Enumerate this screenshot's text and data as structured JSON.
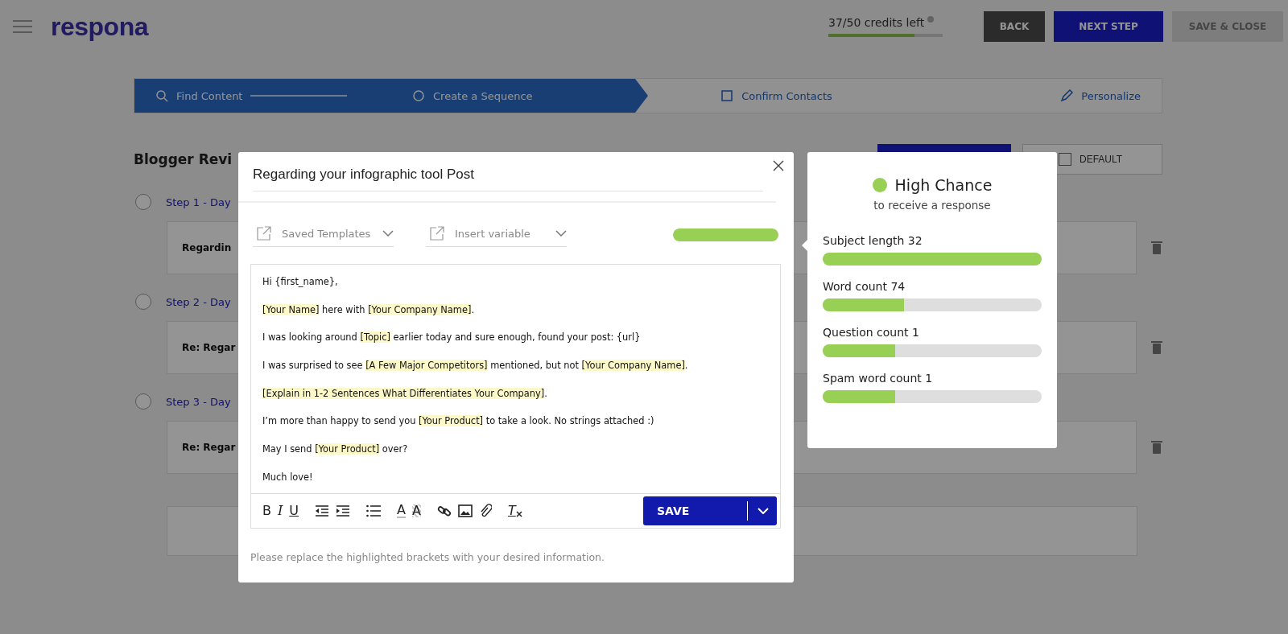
{
  "header": {
    "logo": "respona",
    "credits": {
      "text": "37/50 credits left",
      "level": 0.75
    },
    "buttons": [
      {
        "label": "BACK",
        "kind": "dark"
      },
      {
        "label": "NEXT STEP",
        "kind": "primary"
      },
      {
        "label": "SAVE & CLOSE",
        "kind": "disabled"
      }
    ]
  },
  "stepper": [
    {
      "label": "Find Content",
      "kind": "search",
      "selected": true
    },
    {
      "label": "Create a Sequence",
      "kind": "cycle",
      "selected": true
    },
    {
      "label": "Confirm Contacts",
      "kind": "contacts",
      "selected": false
    },
    {
      "label": "Personalize",
      "kind": "edit",
      "selected": false
    }
  ],
  "sequence": {
    "title": "Blogger Revi",
    "default_button": "DEFAULT",
    "steps": [
      {
        "label": "Step 1 - Day",
        "subject": "Regardin",
        "checked": false
      },
      {
        "label": "Step 2 - Day",
        "subject": "Re: Regar",
        "checked": false
      },
      {
        "label": "Step 3 - Day",
        "subject": "Re: Regar",
        "checked": false
      }
    ]
  },
  "modal": {
    "subject": "Regarding your infographic tool Post",
    "dropdowns": [
      {
        "label": "Saved Templates"
      },
      {
        "label": "Insert variable"
      }
    ],
    "score_meter": {
      "level": 1
    },
    "body": [
      [
        {
          "text": "Hi {first_name},",
          "highlighted": false
        }
      ],
      [
        {
          "text": "[Your Name]",
          "highlighted": true
        },
        {
          "text": " here with ",
          "highlighted": false
        },
        {
          "text": "[Your Company Name]",
          "highlighted": true
        },
        {
          "text": ".",
          "highlighted": false
        }
      ],
      [
        {
          "text": "I was looking around ",
          "highlighted": false
        },
        {
          "text": "[Topic]",
          "highlighted": true
        },
        {
          "text": " earlier today and sure enough, found your post: {url}",
          "highlighted": false
        }
      ],
      [
        {
          "text": "I was surprised to see ",
          "highlighted": false
        },
        {
          "text": "[A Few Major Competitors]",
          "highlighted": true
        },
        {
          "text": " mentioned, but not ",
          "highlighted": false
        },
        {
          "text": "[Your Company Name]",
          "highlighted": true
        },
        {
          "text": ".",
          "highlighted": false
        }
      ],
      [
        {
          "text": "[Explain in 1-2 Sentences What Differentiates Your Company]",
          "highlighted": true
        },
        {
          "text": ".",
          "highlighted": false
        }
      ],
      [
        {
          "text": "I’m more than happy to send you ",
          "highlighted": false
        },
        {
          "text": "[Your Product]",
          "highlighted": true
        },
        {
          "text": " to take a look. No strings attached :)",
          "highlighted": false
        }
      ],
      [
        {
          "text": "May I send ",
          "highlighted": false
        },
        {
          "text": "[Your Product]",
          "highlighted": true
        },
        {
          "text": " over?",
          "highlighted": false
        }
      ],
      [
        {
          "text": "Much love!",
          "highlighted": false
        }
      ]
    ],
    "toolbar": [
      {
        "kind": "bold",
        "label": "B"
      },
      {
        "kind": "italic",
        "label": "I"
      },
      {
        "kind": "underline",
        "label": "U"
      },
      {
        "kind": "outdent"
      },
      {
        "kind": "indent"
      },
      {
        "kind": "bullets"
      },
      {
        "kind": "text-color",
        "label": "A"
      },
      {
        "kind": "highlight",
        "label": "A"
      },
      {
        "kind": "link"
      },
      {
        "kind": "image"
      },
      {
        "kind": "attach"
      },
      {
        "kind": "clear",
        "label": "T"
      }
    ],
    "save_button": "SAVE",
    "note": "Please replace the highlighted brackets with your desired information."
  },
  "analysis": {
    "chance": {
      "title": "High Chance",
      "subtitle": "to receive a response",
      "color": "#97d055"
    },
    "metrics": [
      {
        "label": "Subject length 32",
        "level": 1
      },
      {
        "label": "Word count 74",
        "level": 0.37
      },
      {
        "label": "Question count 1",
        "level": 0.33
      },
      {
        "label": "Spam word count 1",
        "level": 0.33
      }
    ]
  }
}
